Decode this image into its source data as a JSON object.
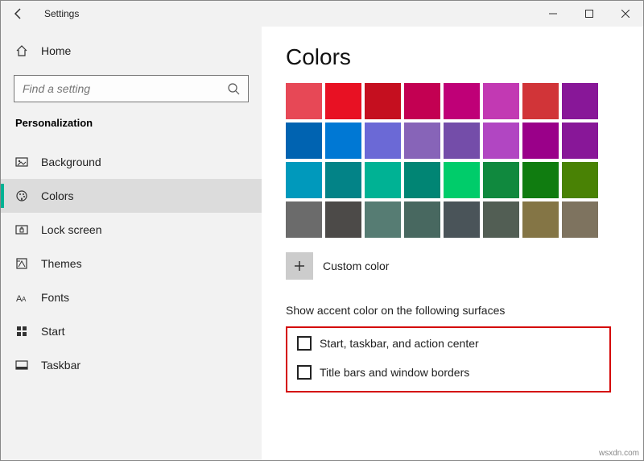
{
  "title": "Settings",
  "home_label": "Home",
  "search_placeholder": "Find a setting",
  "category": "Personalization",
  "nav": [
    {
      "id": "background",
      "label": "Background"
    },
    {
      "id": "colors",
      "label": "Colors",
      "selected": true
    },
    {
      "id": "lockscreen",
      "label": "Lock screen"
    },
    {
      "id": "themes",
      "label": "Themes"
    },
    {
      "id": "fonts",
      "label": "Fonts"
    },
    {
      "id": "start",
      "label": "Start"
    },
    {
      "id": "taskbar",
      "label": "Taskbar"
    }
  ],
  "heading": "Colors",
  "palette": [
    "#e74856",
    "#e81123",
    "#c50f1f",
    "#c30052",
    "#bf0077",
    "#c239b3",
    "#d13438",
    "#881798",
    "#0063b1",
    "#0078d4",
    "#6b69d6",
    "#8764b8",
    "#744da9",
    "#b146c2",
    "#9a0089",
    "#881798",
    "#0099bc",
    "#038387",
    "#00b294",
    "#018574",
    "#00cc6a",
    "#10893e",
    "#107c10",
    "#498205",
    "#6b6b6b",
    "#4c4a48",
    "#567c73",
    "#486860",
    "#4a5459",
    "#525e54",
    "#847545",
    "#7e735f"
  ],
  "custom_label": "Custom color",
  "surfaces_heading": "Show accent color on the following surfaces",
  "check1_label": "Start, taskbar, and action center",
  "check2_label": "Title bars and window borders",
  "watermark": "wsxdn.com"
}
